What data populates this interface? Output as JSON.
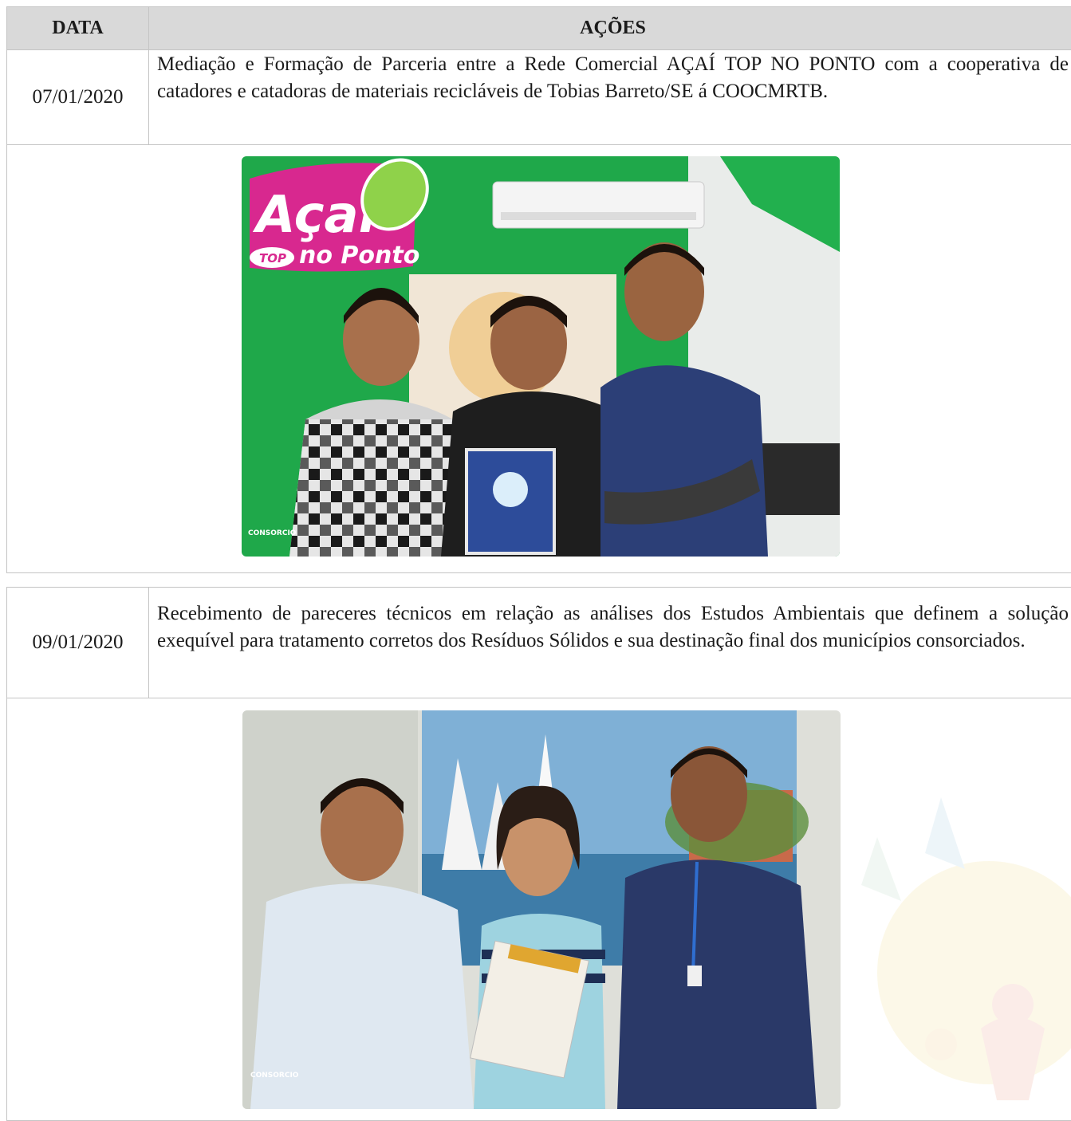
{
  "table": {
    "headers": {
      "date": "DATA",
      "actions": "AÇÕES"
    }
  },
  "entries": [
    {
      "date": "07/01/2020",
      "text": "Mediação e Formação de Parceria entre a Rede Comercial AÇAÍ TOP NO PONTO com a cooperativa de catadores e catadoras de materiais recicláveis de Tobias Barreto/SE á COOCMRTB.",
      "photo": {
        "sign_main": "Açai",
        "sign_top": "TOP",
        "sign_sub": "no Ponto",
        "watermark_label": "CONSORCIO"
      }
    },
    {
      "date": "09/01/2020",
      "text": "Recebimento de pareceres técnicos em relação as análises dos Estudos Ambientais que definem a solução exequível para tratamento corretos dos Resíduos Sólidos e sua destinação final dos municípios consorciados.",
      "photo": {
        "watermark_label": "CONSORCIO"
      }
    }
  ]
}
